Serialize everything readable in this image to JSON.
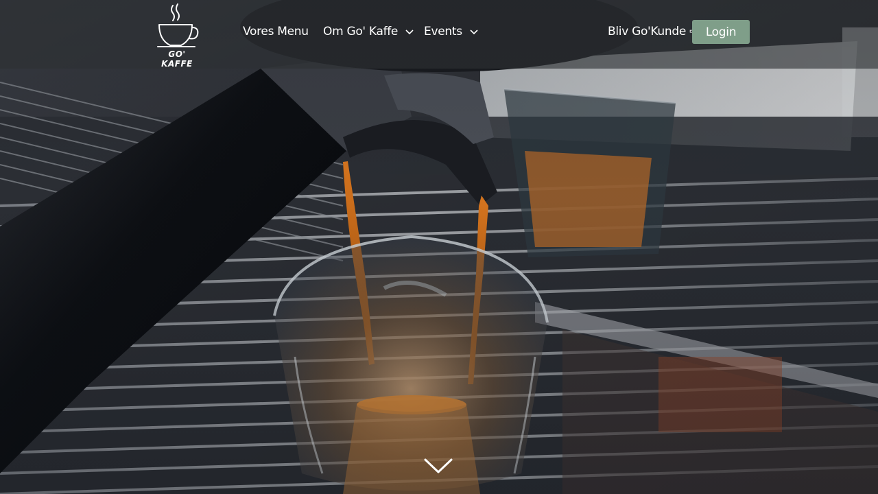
{
  "brand": {
    "logo_text": "GO' KAFFE"
  },
  "nav": {
    "menu_label": "Vores Menu",
    "about_label": "Om Go' Kaffe",
    "events_label": "Events",
    "signup_label": "Bliv Go'Kunde ⇨",
    "login_label": "Login"
  },
  "colors": {
    "accent": "#7f9e89",
    "navbar_bg": "#2d3034"
  },
  "icons": {
    "logo": "coffee-cup-logo-icon",
    "dropdown": "chevron-down-icon",
    "scroll": "chevron-down-icon"
  },
  "hero": {
    "image_subject": "espresso pouring into glass"
  }
}
